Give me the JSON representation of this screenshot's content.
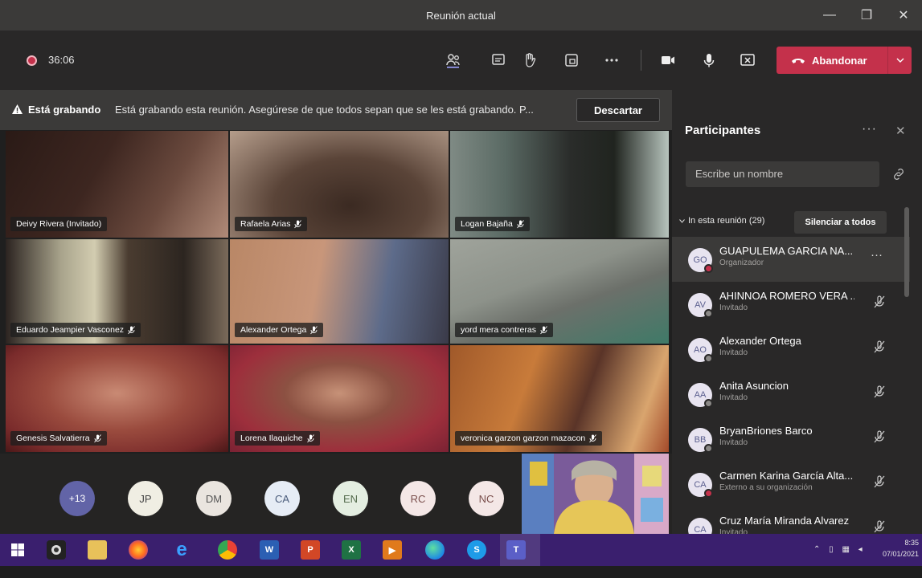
{
  "window": {
    "title": "Reunión actual",
    "minimize": "—",
    "maximize": "❐",
    "close": "✕"
  },
  "toolbar": {
    "timer": "36:06",
    "icons": [
      "participants-icon",
      "chat-icon",
      "raise-hand-icon",
      "share-tray-icon",
      "more-actions-icon",
      "camera-icon",
      "microphone-icon",
      "share-screen-icon"
    ],
    "leave_label": "Abandonar",
    "leave_color": "#c4314b"
  },
  "banner": {
    "title": "Está grabando",
    "text": "Está grabando esta reunión. Asegúrese de que todos sepan que se les está grabando. P...",
    "dismiss": "Descartar"
  },
  "tiles": [
    {
      "name": "Deivy Rivera (Invitado)",
      "muted": false
    },
    {
      "name": "Rafaela Arias",
      "muted": true
    },
    {
      "name": "Logan Bajaña",
      "muted": true
    },
    {
      "name": "Eduardo Jeampier Vasconez",
      "muted": true
    },
    {
      "name": "Alexander Ortega",
      "muted": true
    },
    {
      "name": "yord mera contreras",
      "muted": true
    },
    {
      "name": "Genesis Salvatierra",
      "muted": true
    },
    {
      "name": "Lorena Ilaquiche",
      "muted": true
    },
    {
      "name": "veronica garzon garzon mazacon",
      "muted": true
    }
  ],
  "avatars": [
    "+13",
    "JP",
    "DM",
    "CA",
    "EN",
    "RC",
    "NC"
  ],
  "panel": {
    "title": "Participantes",
    "more": "···",
    "close": "✕",
    "search_placeholder": "Escribe un nombre",
    "section": "In esta reunión (29)",
    "mute_all": "Silenciar a todos",
    "participants": [
      {
        "initials": "GO",
        "name": "GUAPULEMA GARCIA NA...",
        "role": "Organizador"
      },
      {
        "initials": "AV",
        "name": "AHINNOA ROMERO VERA ...",
        "role": "Invitado"
      },
      {
        "initials": "AO",
        "name": "Alexander Ortega",
        "role": "Invitado"
      },
      {
        "initials": "AA",
        "name": "Anita Asuncion",
        "role": "Invitado"
      },
      {
        "initials": "BB",
        "name": "BryanBriones Barco",
        "role": "Invitado"
      },
      {
        "initials": "CA",
        "name": "Carmen Karina García Alta...",
        "role": "Externo a su organización"
      },
      {
        "initials": "CA",
        "name": "Cruz María Miranda Alvarez",
        "role": "Invitado"
      }
    ]
  },
  "taskbar": {
    "apps": [
      "windows-start-icon",
      "camera-app-icon",
      "file-explorer-icon",
      "firefox-icon",
      "internet-explorer-icon",
      "chrome-icon",
      "word-icon",
      "powerpoint-icon",
      "excel-icon",
      "media-player-icon",
      "edge-icon",
      "skype-icon",
      "teams-icon"
    ],
    "time": "8:35",
    "date": "07/01/2021"
  }
}
